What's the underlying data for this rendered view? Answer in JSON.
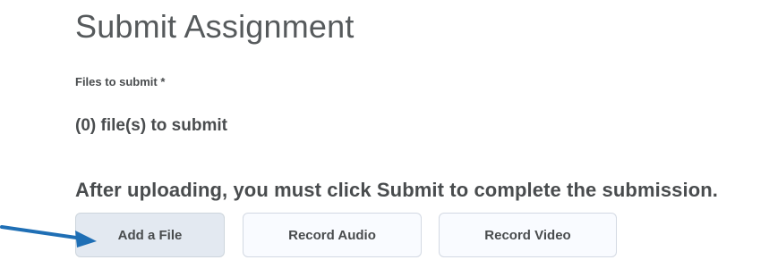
{
  "page": {
    "title": "Submit Assignment"
  },
  "files": {
    "label": "Files to submit *",
    "count_text": "(0) file(s) to submit"
  },
  "instruction": "After uploading, you must click Submit to complete the submission.",
  "buttons": {
    "add_file": "Add a File",
    "record_audio": "Record Audio",
    "record_video": "Record Video"
  },
  "annotation": {
    "arrow_icon": "arrow-right-icon",
    "arrow_color": "#1f6fb5"
  }
}
